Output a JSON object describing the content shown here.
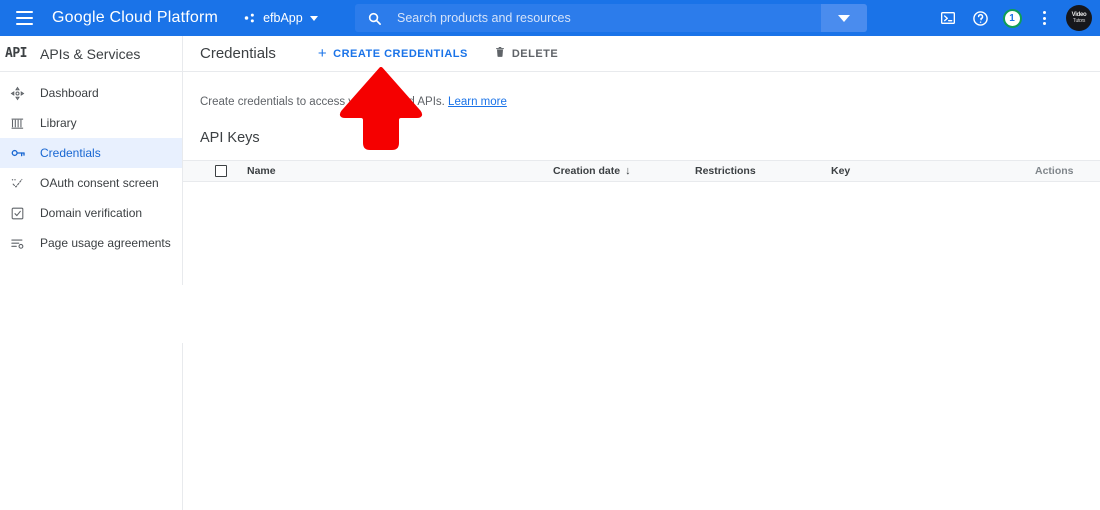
{
  "topbar": {
    "menu_icon": "hamburger-icon",
    "brand": "Google Cloud Platform",
    "project": {
      "icon": "project-icon",
      "name": "efbApp",
      "caret": "chevron-down-icon"
    },
    "search": {
      "icon": "search-icon",
      "placeholder": "Search products and resources",
      "value": "",
      "expand_icon": "chevron-down-icon"
    },
    "icons": [
      {
        "name": "cloud-shell-icon",
        "title": "Activate Cloud Shell"
      },
      {
        "name": "help-icon",
        "title": "Help"
      },
      {
        "name": "status-badge",
        "title": "Notifications",
        "count": "1"
      },
      {
        "name": "more-vert-icon",
        "title": "More options"
      }
    ],
    "avatar": {
      "name": "avatar",
      "line1": "Video",
      "line2": "Tutors"
    },
    "accent_blue": "#1a73e8",
    "search_blue": "#2c7ceb",
    "badge_green": "#0f9d58"
  },
  "sidebar": {
    "logo_text": "API",
    "title": "APIs & Services",
    "items": [
      {
        "label": "Dashboard",
        "icon": "dashboard-icon",
        "active": false
      },
      {
        "label": "Library",
        "icon": "library-icon",
        "active": false
      },
      {
        "label": "Credentials",
        "icon": "key-icon",
        "active": true
      },
      {
        "label": "OAuth consent screen",
        "icon": "oauth-consent-icon",
        "active": false
      },
      {
        "label": "Domain verification",
        "icon": "domain-verification-icon",
        "active": false
      },
      {
        "label": "Page usage agreements",
        "icon": "page-usage-icon",
        "active": false
      }
    ],
    "active_bg": "#e8f0fe",
    "active_fg": "#1967d2"
  },
  "content": {
    "page_title": "Credentials",
    "create_button": {
      "label": "CREATE CREDENTIALS",
      "icon": "plus-icon"
    },
    "delete_button": {
      "label": "DELETE",
      "icon": "trash-icon"
    },
    "description": {
      "text": "Create credentials to access your enabled APIs.",
      "link_label": "Learn more"
    },
    "section_title": "API Keys",
    "table": {
      "select_all_checkbox": "select-all-checkbox",
      "columns": [
        {
          "label": "Name",
          "sorted": false
        },
        {
          "label": "Creation date",
          "sorted": true,
          "sort_icon": "↓"
        },
        {
          "label": "Restrictions",
          "sorted": false
        },
        {
          "label": "Key",
          "sorted": false
        },
        {
          "label": "Actions",
          "sorted": false
        }
      ],
      "rows": []
    }
  },
  "overlay": {
    "arrow": {
      "name": "red-arrow-annotation",
      "color": "#F50000",
      "direction": "up"
    }
  }
}
